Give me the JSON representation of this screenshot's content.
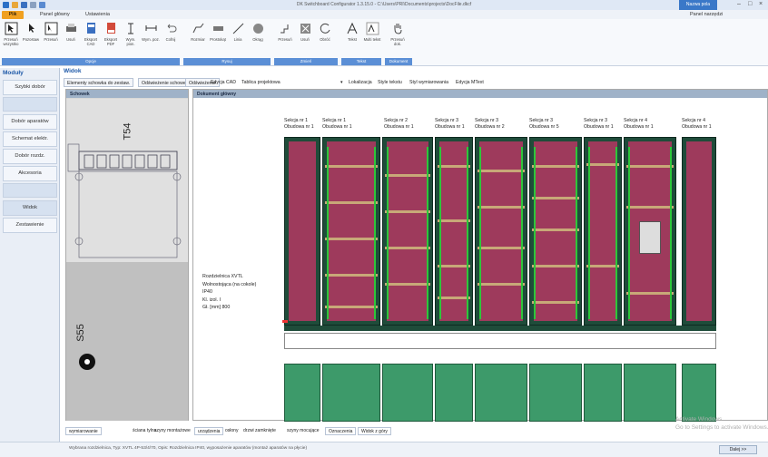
{
  "window": {
    "title": "DK Switchboard Configurator 1.3.15.0 - C:\\Users\\PRI\\Documents\\projects\\DocFile.dkcf",
    "highlight_button": "Nazwa pola",
    "ribbon_tab_right": "Panel narzędzi"
  },
  "menu": {
    "file": "Plik",
    "tabs": [
      "Panel główny",
      "Ustawienia"
    ]
  },
  "ribbon": {
    "buttons": [
      {
        "label": "Przesuń wszystko"
      },
      {
        "label": "Pozostaw"
      },
      {
        "label": "Przesuń"
      },
      {
        "label": "Usuń"
      },
      {
        "label": "Eksport CAD"
      },
      {
        "label": "Eksport PDF"
      },
      {
        "label": "Wym. pion."
      },
      {
        "label": "Wym. poz."
      },
      {
        "label": "Cofnij"
      },
      {
        "label": "Rozmiar"
      },
      {
        "label": "Prostokąt"
      },
      {
        "label": "Linia"
      },
      {
        "label": "Okrąg"
      },
      {
        "label": "Przesuń"
      },
      {
        "label": "Usuń"
      },
      {
        "label": "Obróć"
      },
      {
        "label": "Tekst"
      },
      {
        "label": "Multi tekst"
      },
      {
        "label": "Przesuń dok."
      }
    ],
    "groups": [
      "Opcje",
      "Rysuj",
      "Zmień",
      "Tekst",
      "Dokument"
    ]
  },
  "left_panel": {
    "title": "Moduły",
    "items": [
      "Szybki dobór",
      "Dobór aparatów",
      "Schemat elektr.",
      "Dobór rozdz.",
      "Akcesoria",
      "Widok",
      "Zestawienie"
    ]
  },
  "main": {
    "title": "Widok",
    "tabs": [
      "Elementy schowka do zestaw.",
      "Odświeżenie schowek",
      "Odświeżenie"
    ],
    "plain_tabs": [
      "Edycja CAD",
      "Tablica projektowa"
    ],
    "right_tabs": [
      "Lokalizacja",
      "Style tekstu",
      "Styl wymiarowania",
      "Edycja MText"
    ],
    "schowek_title": "Schowek",
    "schowek_labels": [
      "T54",
      "S55"
    ],
    "doc_title": "Dokument główny"
  },
  "sections": [
    {
      "line1": "Sekcja nr 1",
      "line2": "Obudowa nr 1"
    },
    {
      "line1": "Sekcja nr 1",
      "line2": "Obudowa nr 1"
    },
    {
      "line1": "Sekcja nr 2",
      "line2": "Obudowa nr 1"
    },
    {
      "line1": "Sekcja nr 3",
      "line2": "Obudowa nr 1"
    },
    {
      "line1": "Sekcja nr 3",
      "line2": "Obudowa nr 2"
    },
    {
      "line1": "Sekcja nr 3",
      "line2": "Obudowa nr 5"
    },
    {
      "line1": "Sekcja nr 3",
      "line2": "Obudowa nr 1"
    },
    {
      "line1": "Sekcja nr 4",
      "line2": "Obudowa nr 1"
    },
    {
      "line1": "Sekcja nr 4",
      "line2": "Obudowa nr 1"
    }
  ],
  "info": {
    "lines": [
      "Rozdzielnica XVTL",
      "Wolnostojąca (na cokole)",
      "IP40",
      "Kl. izol. I",
      "Gł. [mm] 800"
    ]
  },
  "bottom_tabs": [
    "wymiarowanie",
    "ściana tylna",
    "szyny montażowe",
    "urządzenia",
    "osłony",
    "drzwi zamknięte",
    "szyny mocujące",
    "Oznaczenia",
    "Widok z góry"
  ],
  "status": {
    "text": "Wybrana rozdzielnica, Typ: XVTL 4P-53/4/70, Opis: Rozdzielnica IP40, wyposażenie aparatów (montaż aparatów na płycie)",
    "button": "Dalej >>"
  },
  "watermark": [
    "Activate Windows",
    "Go to Settings to activate Windows."
  ]
}
